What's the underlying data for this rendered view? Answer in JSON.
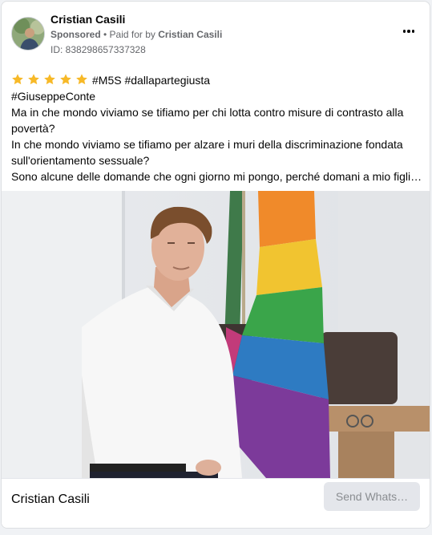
{
  "post": {
    "author": "Cristian Casili",
    "sponsored_label": "Sponsored",
    "paid_for_prefix": "• Paid for by",
    "paid_for_name": "Cristian Casili",
    "ad_id": "ID: 838298657337328",
    "rating_stars": 5,
    "text_lines": {
      "line1": "#M5S #dallapartegiusta",
      "line2": "#GiuseppeConte",
      "line3": "Ma in che mondo viviamo se tifiamo per chi lotta contro misure di contrasto alla",
      "line4": "povertà?",
      "line5": "In che mondo viviamo se tifiamo per alzare i muri della discriminazione fondata",
      "line6": "sull'orientamento sessuale?",
      "line7": "Sono alcune delle domande che ogni giorno mi pongo, perché domani a mio figli…"
    }
  },
  "footer": {
    "page_name": "Cristian Casili",
    "cta_label": "Send Whats…"
  },
  "icons": {
    "more": "more-options-icon",
    "star": "star-icon"
  },
  "colors": {
    "star": "#f7b928",
    "muted_text": "#65676b",
    "cta_bg": "#e4e6eb"
  }
}
